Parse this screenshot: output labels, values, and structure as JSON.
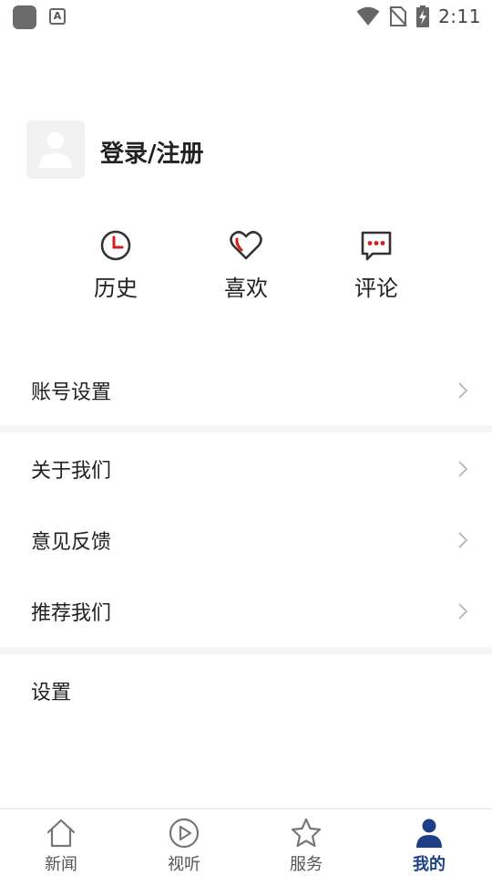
{
  "status_bar": {
    "time": "2:11",
    "a_badge": "A"
  },
  "profile": {
    "login_label": "登录/注册"
  },
  "shortcuts": [
    {
      "label": "历史",
      "icon": "clock-icon"
    },
    {
      "label": "喜欢",
      "icon": "heart-icon"
    },
    {
      "label": "评论",
      "icon": "comment-icon"
    }
  ],
  "menu": {
    "account_settings": "账号设置",
    "about_us": "关于我们",
    "feedback": "意见反馈",
    "recommend_us": "推荐我们",
    "settings": "设置"
  },
  "bottom_nav": [
    {
      "label": "新闻",
      "icon": "home-icon",
      "active": false
    },
    {
      "label": "视听",
      "icon": "play-icon",
      "active": false
    },
    {
      "label": "服务",
      "icon": "star-icon",
      "active": false
    },
    {
      "label": "我的",
      "icon": "person-icon",
      "active": true
    }
  ],
  "colors": {
    "accent": "#1d3f86",
    "icon_red": "#d0201a",
    "icon_dark": "#333333"
  }
}
